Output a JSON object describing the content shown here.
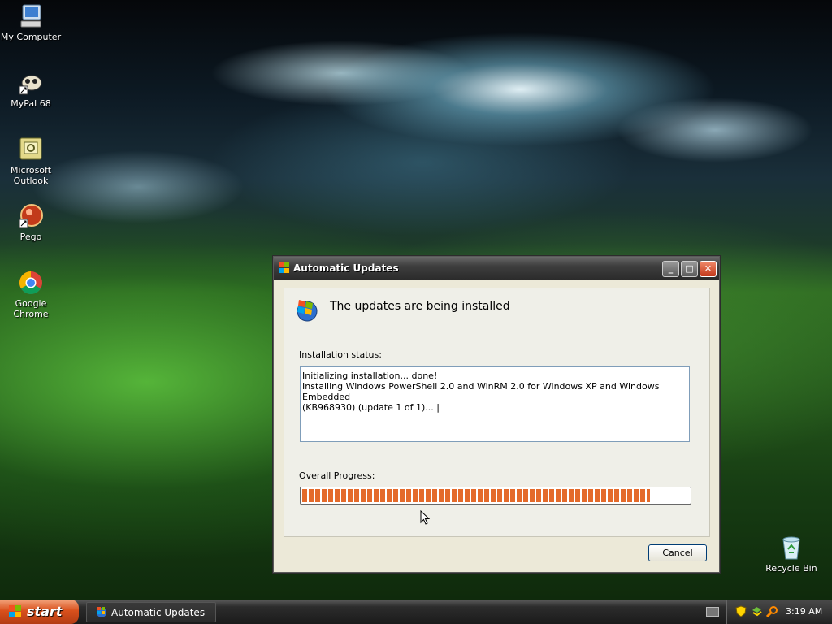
{
  "desktop": {
    "icons": [
      {
        "label": "My Computer"
      },
      {
        "label": "MyPal 68"
      },
      {
        "label": "Microsoft Outlook"
      },
      {
        "label": "Pego"
      },
      {
        "label": "Google Chrome"
      },
      {
        "label": "Recycle Bin"
      }
    ]
  },
  "dialog": {
    "title": "Automatic Updates",
    "heading": "The updates are being installed",
    "status_label": "Installation status:",
    "status_lines": [
      "Initializing installation... done!",
      "Installing Windows PowerShell 2.0 and WinRM 2.0 for Windows XP and Windows Embedded",
      "(KB968930) (update 1 of 1)... |"
    ],
    "progress_label": "Overall Progress:",
    "progress_fraction": 0.9,
    "cancel_label": "Cancel",
    "accent_color": "#e46a2a"
  },
  "taskbar": {
    "start_label": "start",
    "task_label": "Automatic Updates",
    "clock": "3:19 AM"
  }
}
